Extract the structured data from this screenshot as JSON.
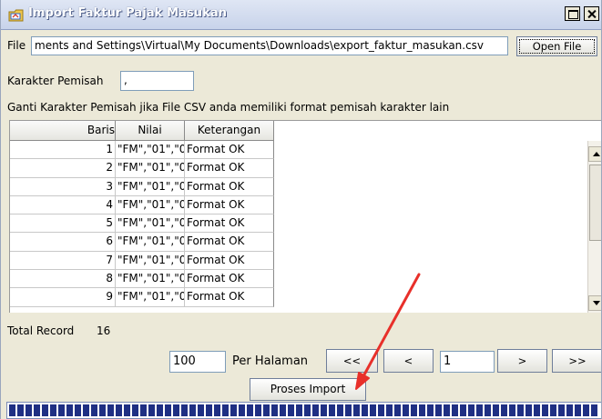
{
  "window": {
    "title": "Import Faktur Pajak Masukan",
    "icon": "folder-icon"
  },
  "file": {
    "label": "File",
    "value": "ments and Settings\\Virtual\\My Documents\\Downloads\\export_faktur_masukan.csv",
    "open_button": "Open File"
  },
  "separator": {
    "label": "Karakter Pemisah",
    "value": ","
  },
  "hint": "Ganti Karakter Pemisah jika File CSV anda memiliki format pemisah karakter lain",
  "table": {
    "headers": [
      "Baris",
      "Nilai",
      "Keterangan"
    ],
    "rows": [
      [
        "1",
        "\"FM\",\"01\",\"0...",
        "Format OK"
      ],
      [
        "2",
        "\"FM\",\"01\",\"0...",
        "Format OK"
      ],
      [
        "3",
        "\"FM\",\"01\",\"0...",
        "Format OK"
      ],
      [
        "4",
        "\"FM\",\"01\",\"0...",
        "Format OK"
      ],
      [
        "5",
        "\"FM\",\"01\",\"0...",
        "Format OK"
      ],
      [
        "6",
        "\"FM\",\"01\",\"0...",
        "Format OK"
      ],
      [
        "7",
        "\"FM\",\"01\",\"0...",
        "Format OK"
      ],
      [
        "8",
        "\"FM\",\"01\",\"0...",
        "Format OK"
      ],
      [
        "9",
        "\"FM\",\"01\",\"0...",
        "Format OK"
      ]
    ]
  },
  "total": {
    "label": "Total Record",
    "value": "16"
  },
  "pagination": {
    "page_size": "100",
    "per_page_label": "Per Halaman",
    "first": "<<",
    "prev": "<",
    "page": "1",
    "next": ">",
    "last": ">>"
  },
  "process_button": "Proses Import",
  "colors": {
    "title_text": "#ffffff",
    "arrow": "#e8302a",
    "progress": "#1f2f83"
  }
}
